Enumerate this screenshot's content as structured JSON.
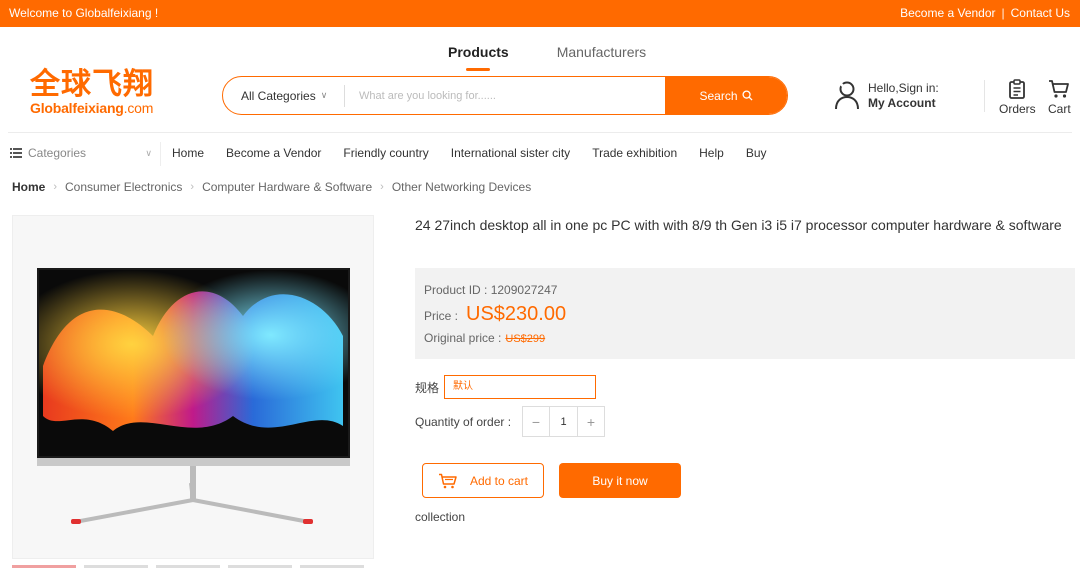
{
  "topbar": {
    "welcome": "Welcome to Globalfeixiang !",
    "become_vendor": "Become a Vendor",
    "separator": "|",
    "contact": "Contact Us",
    "bg_color": "#ff6a00"
  },
  "header": {
    "tabs": [
      "Products",
      "Manufacturers"
    ],
    "active_tab": "Products",
    "logo_cn": "全球飞翔",
    "logo_en_main": "Globalfeixiang",
    "logo_en_suffix": ".com"
  },
  "search": {
    "category": "All Categories",
    "placeholder": "What are you looking for......",
    "button": "Search"
  },
  "account": {
    "greeting": "Hello,Sign in:",
    "label": "My Account",
    "orders": "Orders",
    "cart": "Cart"
  },
  "nav": {
    "categories": "Categories",
    "items": [
      "Home",
      "Become a Vendor",
      "Friendly country",
      "International sister city",
      "Trade exhibition",
      "Help",
      "Buy"
    ]
  },
  "breadcrumb": [
    "Home",
    "Consumer Electronics",
    "Computer Hardware & Software",
    "Other Networking Devices"
  ],
  "product": {
    "title": "24 27inch desktop all in one pc PC with with 8/9 th Gen i3 i5 i7 processor computer hardware & software",
    "id_label": "Product ID :",
    "id": "1209027247",
    "price_label": "Price :",
    "price": "US$230.00",
    "orig_label": "Original price :",
    "orig_price": "US$299",
    "spec_label": "规格",
    "spec_value": "默认",
    "qty_label": "Quantity of order :",
    "qty": "1",
    "add_to_cart": "Add to cart",
    "buy_now": "Buy it now",
    "collection": "collection"
  },
  "colors": {
    "accent": "#ff6a00"
  }
}
